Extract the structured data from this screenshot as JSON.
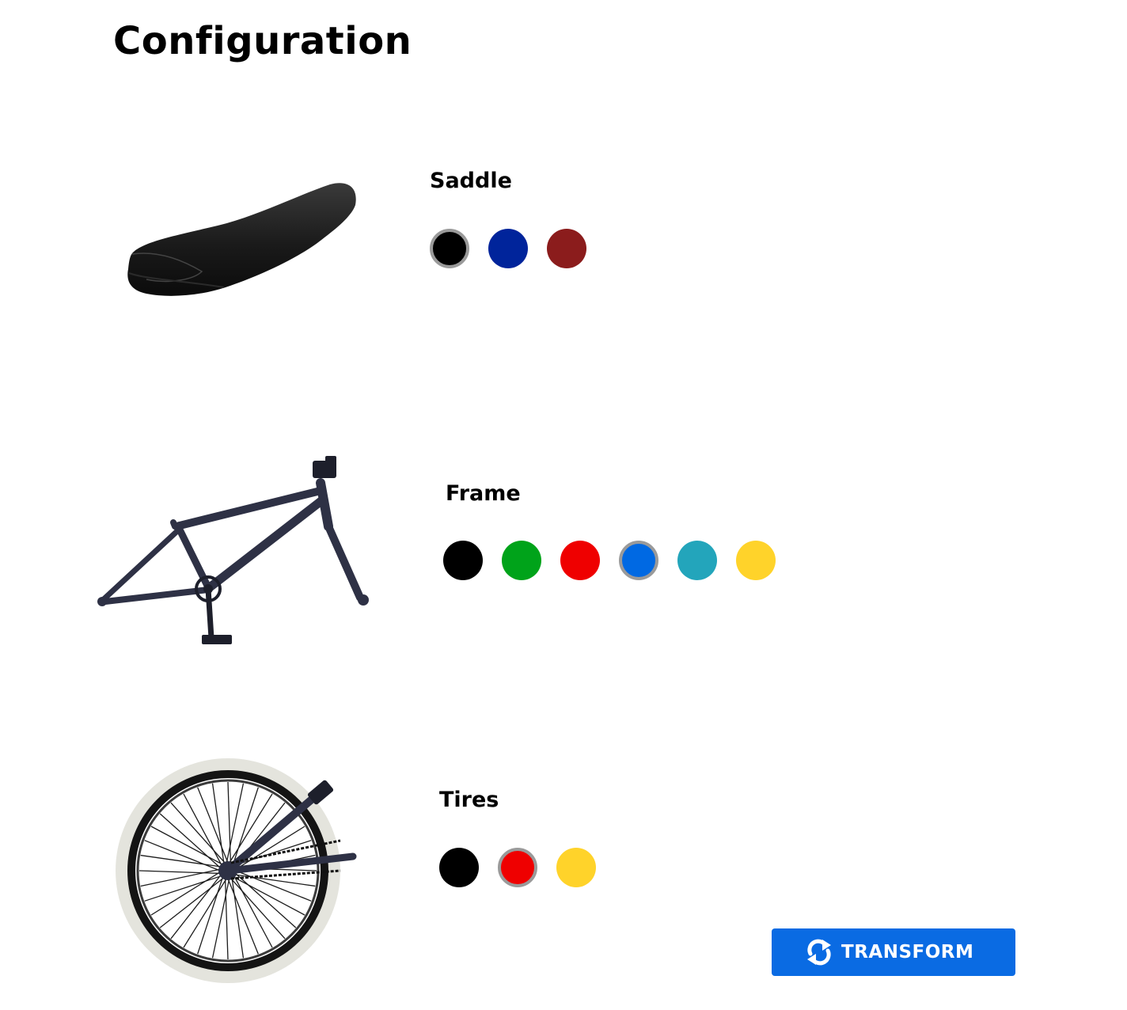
{
  "page": {
    "title": "Configuration"
  },
  "sections": [
    {
      "name": "Saddle",
      "swatches": [
        "#000000",
        "#00249b",
        "#8b1c1c"
      ],
      "selected_color": "#000000"
    },
    {
      "name": "Frame",
      "swatches": [
        "#000000",
        "#00a31a",
        "#ef0000",
        "#0069e3",
        "#23a5bb",
        "#ffd32a"
      ],
      "selected_color": "#0069e3"
    },
    {
      "name": "Tires",
      "swatches": [
        "#000000",
        "#ef0000",
        "#ffd32a"
      ],
      "selected_color": "#ef0000"
    }
  ],
  "transform_button": {
    "label": "TRANSFORM",
    "color": "#0a6be3",
    "icon": "refresh-icon"
  },
  "colors": {
    "swatch_selected_ring": "#9a9a9a",
    "frame_paint": "#2e3145"
  }
}
